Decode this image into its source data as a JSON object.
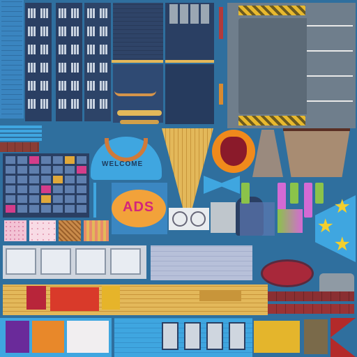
{
  "atlas": {
    "sign_text": "WELCOME",
    "logo_text": "ADS",
    "palette": {
      "background": "#2f6f9e",
      "building_dark": "#2a3f63",
      "building_light": "#3a5b8a",
      "window": "#3a4f78",
      "wood": "#e3b85a",
      "wood_dark": "#c8953a",
      "brick": "#8a3d35",
      "panel_blue": "#3fa6e0",
      "parking_gray": "#6f7e8c",
      "hazard_yellow": "#e8b92e",
      "star": "#f3cf2d",
      "awning": "#9a8a7e"
    },
    "regions": [
      "building-facade-left",
      "building-facade-tower-1",
      "building-facade-tower-2",
      "brick-wall-panel",
      "rooftop-window",
      "rooftop-parking-lot",
      "welcome-arch-sign",
      "wood-floor-triangle",
      "round-logo-emblem",
      "tan-awning-left",
      "tan-awning-right",
      "window-grid-panel",
      "ads-logo-sign",
      "hvac-fan-units",
      "neon-bars",
      "gold-stars",
      "storefront-row",
      "poster-row-bottom",
      "wood-plank-strip",
      "red-oval-mat"
    ]
  }
}
